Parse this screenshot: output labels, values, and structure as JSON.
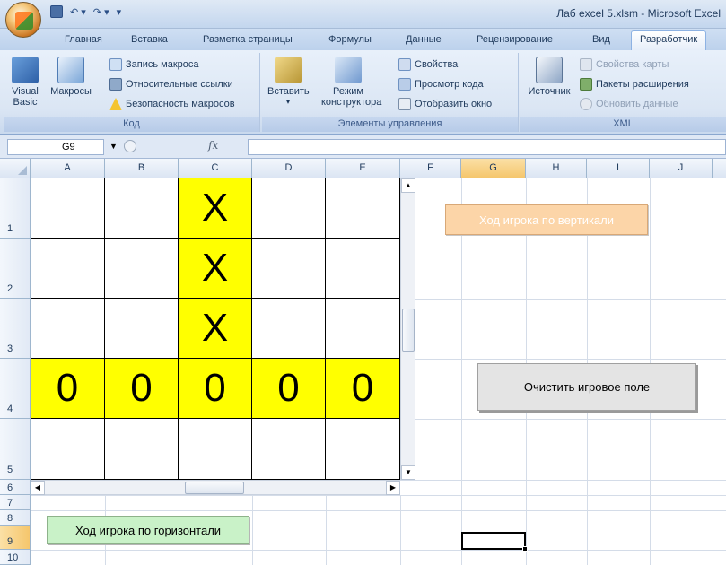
{
  "window": {
    "title": "Лаб excel 5.xlsm - Microsoft Excel"
  },
  "ribbon_tabs": [
    "Главная",
    "Вставка",
    "Разметка страницы",
    "Формулы",
    "Данные",
    "Рецензирование",
    "Вид",
    "Разработчик"
  ],
  "active_tab": "Разработчик",
  "groups": {
    "code": {
      "label": "Код",
      "visual_basic": "Visual Basic",
      "macros": "Макросы",
      "record_macro": "Запись макроса",
      "relative_refs": "Относительные ссылки",
      "macro_security": "Безопасность макросов"
    },
    "controls": {
      "label": "Элементы управления",
      "insert": "Вставить",
      "design_mode": "Режим конструктора",
      "properties": "Свойства",
      "view_code": "Просмотр кода",
      "run_dialog": "Отобразить окно"
    },
    "xml": {
      "label": "XML",
      "source": "Источник",
      "map_properties": "Свойства карты",
      "expansion_packs": "Пакеты расширения",
      "refresh_data": "Обновить данные"
    }
  },
  "formula_bar": {
    "name_box": "G9",
    "fx": "fx",
    "value": ""
  },
  "columns": [
    "A",
    "B",
    "C",
    "D",
    "E",
    "F",
    "G",
    "H",
    "I",
    "J"
  ],
  "selected_column": "G",
  "rows": [
    "1",
    "2",
    "3",
    "4",
    "5",
    "6",
    "7",
    "8",
    "9",
    "10"
  ],
  "selected_row": "9",
  "board": [
    [
      "",
      "",
      "X",
      "",
      ""
    ],
    [
      "",
      "",
      "X",
      "",
      ""
    ],
    [
      "",
      "",
      "X",
      "",
      ""
    ],
    [
      "0",
      "0",
      "0",
      "0",
      "0"
    ],
    [
      "",
      "",
      "",
      "",
      ""
    ]
  ],
  "buttons": {
    "vertical_move": "Ход игрока по вертикали",
    "clear_board": "Очистить игровое поле",
    "horizontal_move": "Ход игрока по горизонтали"
  },
  "colors": {
    "highlight": "#ffff00",
    "vertical_button": "#fcd5a8",
    "horizontal_button": "#c9f2c8",
    "clear_button": "#e4e4e4"
  }
}
